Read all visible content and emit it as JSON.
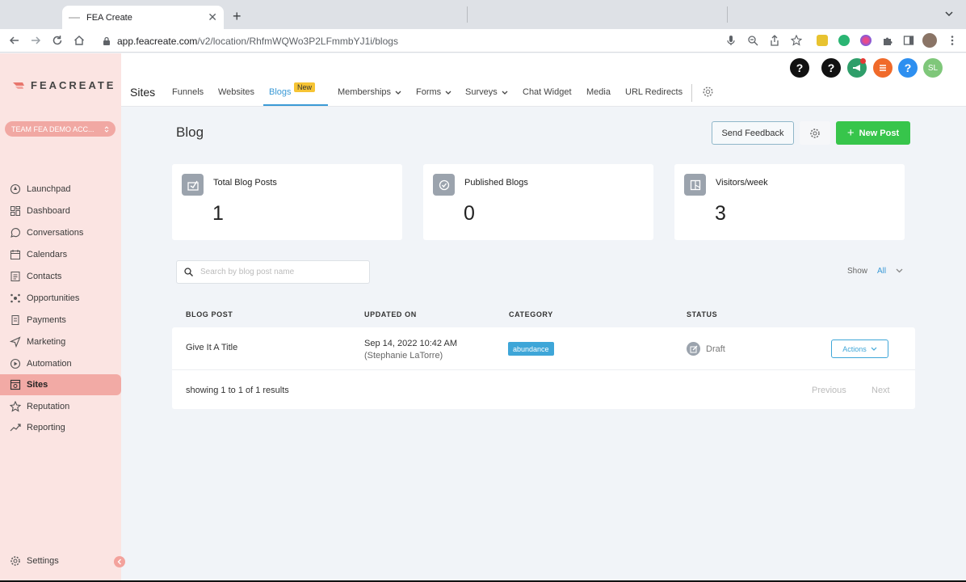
{
  "browser": {
    "tab_title": "FEA Create",
    "url_host": "app.feacreate.com",
    "url_path": "/v2/location/RhfmWQWo3P2LFmmbYJ1i/blogs",
    "profile_initial": ""
  },
  "sidebar": {
    "logo_text": "FEACREATE",
    "location": "TEAM FEA DEMO ACC...",
    "items": [
      {
        "label": "Launchpad",
        "icon": "rocket-icon"
      },
      {
        "label": "Dashboard",
        "icon": "grid-icon"
      },
      {
        "label": "Conversations",
        "icon": "chat-icon"
      },
      {
        "label": "Calendars",
        "icon": "calendar-icon"
      },
      {
        "label": "Contacts",
        "icon": "contacts-icon"
      },
      {
        "label": "Opportunities",
        "icon": "opportunities-icon"
      },
      {
        "label": "Payments",
        "icon": "payments-icon"
      },
      {
        "label": "Marketing",
        "icon": "send-icon"
      },
      {
        "label": "Automation",
        "icon": "automation-icon"
      },
      {
        "label": "Sites",
        "icon": "sites-icon"
      },
      {
        "label": "Reputation",
        "icon": "star-icon"
      },
      {
        "label": "Reporting",
        "icon": "trend-icon"
      }
    ],
    "settings_label": "Settings",
    "active_item": "Sites"
  },
  "header": {
    "help_1": "?",
    "help_2": "?",
    "help_3": "?",
    "avatar_initials": "SL",
    "colors": {
      "black": "#111111",
      "green": "#2f9e6a",
      "orange": "#f06a2a",
      "blue": "#2d8ff0",
      "avatar": "#7fc77a"
    }
  },
  "subnav": {
    "title": "Sites",
    "items": [
      {
        "label": "Funnels"
      },
      {
        "label": "Websites"
      },
      {
        "label": "Blogs",
        "badge": "New",
        "active": true
      },
      {
        "label": "Memberships",
        "dropdown": true
      },
      {
        "label": "Forms",
        "dropdown": true
      },
      {
        "label": "Surveys",
        "dropdown": true
      },
      {
        "label": "Chat Widget"
      },
      {
        "label": "Media"
      },
      {
        "label": "URL Redirects"
      }
    ]
  },
  "page": {
    "title": "Blog",
    "send_feedback": "Send Feedback",
    "new_post": "New Post",
    "accent_green": "#37c54b"
  },
  "stats": [
    {
      "label": "Total Blog Posts",
      "value": "1",
      "icon": "blog-post-icon"
    },
    {
      "label": "Published Blogs",
      "value": "0",
      "icon": "published-icon"
    },
    {
      "label": "Visitors/week",
      "value": "3",
      "icon": "visitors-icon"
    }
  ],
  "search": {
    "placeholder": "Search by blog post name"
  },
  "filter": {
    "show_label": "Show",
    "show_value": "All"
  },
  "table": {
    "headers": [
      "BLOG POST",
      "UPDATED ON",
      "CATEGORY",
      "STATUS"
    ],
    "rows": [
      {
        "title": "Give It A Title",
        "updated": "Sep 14, 2022 10:42 AM",
        "updated_by": "(Stephanie LaTorre)",
        "category": "abundance",
        "status": "Draft",
        "actions": "Actions"
      }
    ],
    "footer": "showing 1 to 1 of 1 results",
    "previous": "Previous",
    "next": "Next"
  }
}
